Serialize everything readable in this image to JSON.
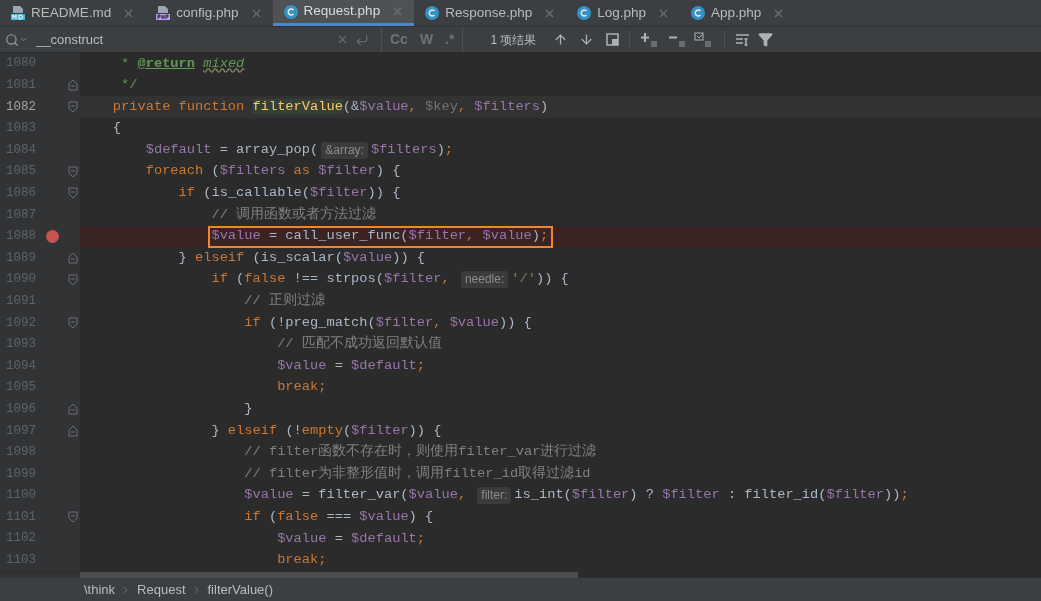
{
  "tabs": [
    {
      "label": "README.md",
      "kind": "markdown",
      "selected": false
    },
    {
      "label": "config.php",
      "kind": "php",
      "selected": false
    },
    {
      "label": "Request.php",
      "kind": "class",
      "selected": true
    },
    {
      "label": "Response.php",
      "kind": "class",
      "selected": false
    },
    {
      "label": "Log.php",
      "kind": "class",
      "selected": false
    },
    {
      "label": "App.php",
      "kind": "class",
      "selected": false
    }
  ],
  "search": {
    "value": "__construct",
    "case_toggle": "Cc",
    "word_toggle": "W",
    "regex_toggle": ".*",
    "result": "1 项结果"
  },
  "lines": [
    {
      "number": "1080",
      "tokens": [
        {
          "t": "     * ",
          "kind": "doc"
        },
        {
          "t": "@return",
          "kind": "doctag"
        },
        {
          "t": " mixed",
          "kind": "doctype"
        }
      ]
    },
    {
      "number": "1081",
      "fold_end": true,
      "tokens": [
        {
          "t": "     */",
          "kind": "doc"
        }
      ]
    },
    {
      "number": "1082",
      "fold_start": true,
      "current": true,
      "tokens": [
        {
          "t": "    private function ",
          "kind": "kw"
        },
        {
          "t": "filterValue",
          "kind": "decl"
        },
        {
          "t": "(&",
          "kind": "plain"
        },
        {
          "t": "$value",
          "kind": "var"
        },
        {
          "t": ", ",
          "kind": "kw"
        },
        {
          "t": "$key",
          "kind": "unused"
        },
        {
          "t": ", ",
          "kind": "kw"
        },
        {
          "t": "$filters",
          "kind": "var"
        },
        {
          "t": ")",
          "kind": "plain"
        }
      ]
    },
    {
      "number": "1083",
      "tokens": [
        {
          "t": "    {",
          "kind": "plain"
        }
      ]
    },
    {
      "number": "1084",
      "tokens": [
        {
          "t": "        $default",
          "kind": "var"
        },
        {
          "t": " = array_pop(",
          "kind": "plain"
        },
        {
          "t": "&array:",
          "kind": "hint"
        },
        {
          "t": "$filters",
          "kind": "var"
        },
        {
          "t": ")",
          "kind": "plain"
        },
        {
          "t": ";",
          "kind": "kw"
        }
      ]
    },
    {
      "number": "1085",
      "fold_start": true,
      "tokens": [
        {
          "t": "        foreach",
          "kind": "kw"
        },
        {
          "t": " (",
          "kind": "plain"
        },
        {
          "t": "$filters",
          "kind": "var"
        },
        {
          "t": " as ",
          "kind": "kw"
        },
        {
          "t": "$filter",
          "kind": "var"
        },
        {
          "t": ") {",
          "kind": "plain"
        }
      ]
    },
    {
      "number": "1086",
      "fold_start": true,
      "tokens": [
        {
          "t": "            if",
          "kind": "kw"
        },
        {
          "t": " (is_callable(",
          "kind": "plain"
        },
        {
          "t": "$filter",
          "kind": "var"
        },
        {
          "t": ")) {",
          "kind": "plain"
        }
      ]
    },
    {
      "number": "1087",
      "tokens": [
        {
          "t": "                // 调用函数或者方法过滤",
          "kind": "comment"
        }
      ]
    },
    {
      "number": "1088",
      "breakpoint": true,
      "boxed": true,
      "tokens": [
        {
          "t": "                $value",
          "kind": "var"
        },
        {
          "t": " = call_user_func(",
          "kind": "plain"
        },
        {
          "t": "$filter",
          "kind": "var"
        },
        {
          "t": ", ",
          "kind": "kw"
        },
        {
          "t": "$value",
          "kind": "var"
        },
        {
          "t": ")",
          "kind": "plain"
        },
        {
          "t": ";",
          "kind": "kw"
        }
      ]
    },
    {
      "number": "1089",
      "fold_end": true,
      "tokens": [
        {
          "t": "            } ",
          "kind": "plain"
        },
        {
          "t": "elseif",
          "kind": "kw"
        },
        {
          "t": " (is_scalar(",
          "kind": "plain"
        },
        {
          "t": "$value",
          "kind": "var"
        },
        {
          "t": ")) {",
          "kind": "plain"
        }
      ]
    },
    {
      "number": "1090",
      "fold_start": true,
      "tokens": [
        {
          "t": "                if",
          "kind": "kw"
        },
        {
          "t": " (",
          "kind": "plain"
        },
        {
          "t": "false",
          "kind": "kw"
        },
        {
          "t": " !== strpos(",
          "kind": "plain"
        },
        {
          "t": "$filter",
          "kind": "var"
        },
        {
          "t": ", ",
          "kind": "kw"
        },
        {
          "t": "needle:",
          "kind": "hint"
        },
        {
          "t": "'/'",
          "kind": "str"
        },
        {
          "t": ")) {",
          "kind": "plain"
        }
      ]
    },
    {
      "number": "1091",
      "tokens": [
        {
          "t": "                    // 正则过滤",
          "kind": "comment"
        }
      ]
    },
    {
      "number": "1092",
      "fold_start": true,
      "tokens": [
        {
          "t": "                    if",
          "kind": "kw"
        },
        {
          "t": " (!preg_match(",
          "kind": "plain"
        },
        {
          "t": "$filter",
          "kind": "var"
        },
        {
          "t": ", ",
          "kind": "kw"
        },
        {
          "t": "$value",
          "kind": "var"
        },
        {
          "t": ")) {",
          "kind": "plain"
        }
      ]
    },
    {
      "number": "1093",
      "tokens": [
        {
          "t": "                        // 匹配不成功返回默认值",
          "kind": "comment"
        }
      ]
    },
    {
      "number": "1094",
      "tokens": [
        {
          "t": "                        $value",
          "kind": "var"
        },
        {
          "t": " = ",
          "kind": "plain"
        },
        {
          "t": "$default",
          "kind": "var"
        },
        {
          "t": ";",
          "kind": "kw"
        }
      ]
    },
    {
      "number": "1095",
      "tokens": [
        {
          "t": "                        break;",
          "kind": "kw"
        }
      ]
    },
    {
      "number": "1096",
      "fold_end": true,
      "tokens": [
        {
          "t": "                    }",
          "kind": "plain"
        }
      ]
    },
    {
      "number": "1097",
      "fold_end": true,
      "tokens": [
        {
          "t": "                } ",
          "kind": "plain"
        },
        {
          "t": "elseif",
          "kind": "kw"
        },
        {
          "t": " (!",
          "kind": "plain"
        },
        {
          "t": "empty",
          "kind": "kw"
        },
        {
          "t": "(",
          "kind": "plain"
        },
        {
          "t": "$filter",
          "kind": "var"
        },
        {
          "t": ")) {",
          "kind": "plain"
        }
      ]
    },
    {
      "number": "1098",
      "tokens": [
        {
          "t": "                    // filter函数不存在时，则使用filter_var进行过滤",
          "kind": "comment"
        }
      ]
    },
    {
      "number": "1099",
      "tokens": [
        {
          "t": "                    // filter为非整形值时，调用filter_id取得过滤id",
          "kind": "comment"
        }
      ]
    },
    {
      "number": "1100",
      "tokens": [
        {
          "t": "                    $value",
          "kind": "var"
        },
        {
          "t": " = filter_var(",
          "kind": "plain"
        },
        {
          "t": "$value",
          "kind": "var"
        },
        {
          "t": ", ",
          "kind": "kw"
        },
        {
          "t": "filter:",
          "kind": "hint"
        },
        {
          "t": "is_int(",
          "kind": "plain"
        },
        {
          "t": "$filter",
          "kind": "var"
        },
        {
          "t": ") ? ",
          "kind": "plain"
        },
        {
          "t": "$filter",
          "kind": "var"
        },
        {
          "t": " : filter_id(",
          "kind": "plain"
        },
        {
          "t": "$filter",
          "kind": "var"
        },
        {
          "t": "))",
          "kind": "plain"
        },
        {
          "t": ";",
          "kind": "kw"
        }
      ]
    },
    {
      "number": "1101",
      "fold_start": true,
      "tokens": [
        {
          "t": "                    if",
          "kind": "kw"
        },
        {
          "t": " (",
          "kind": "plain"
        },
        {
          "t": "false",
          "kind": "kw"
        },
        {
          "t": " === ",
          "kind": "plain"
        },
        {
          "t": "$value",
          "kind": "var"
        },
        {
          "t": ") {",
          "kind": "plain"
        }
      ]
    },
    {
      "number": "1102",
      "tokens": [
        {
          "t": "                        $value",
          "kind": "var"
        },
        {
          "t": " = ",
          "kind": "plain"
        },
        {
          "t": "$default",
          "kind": "var"
        },
        {
          "t": ";",
          "kind": "kw"
        }
      ]
    },
    {
      "number": "1103",
      "tokens": [
        {
          "t": "                        break;",
          "kind": "kw"
        }
      ]
    }
  ],
  "breadcrumbs": [
    "\\think",
    "Request",
    "filterValue()"
  ]
}
